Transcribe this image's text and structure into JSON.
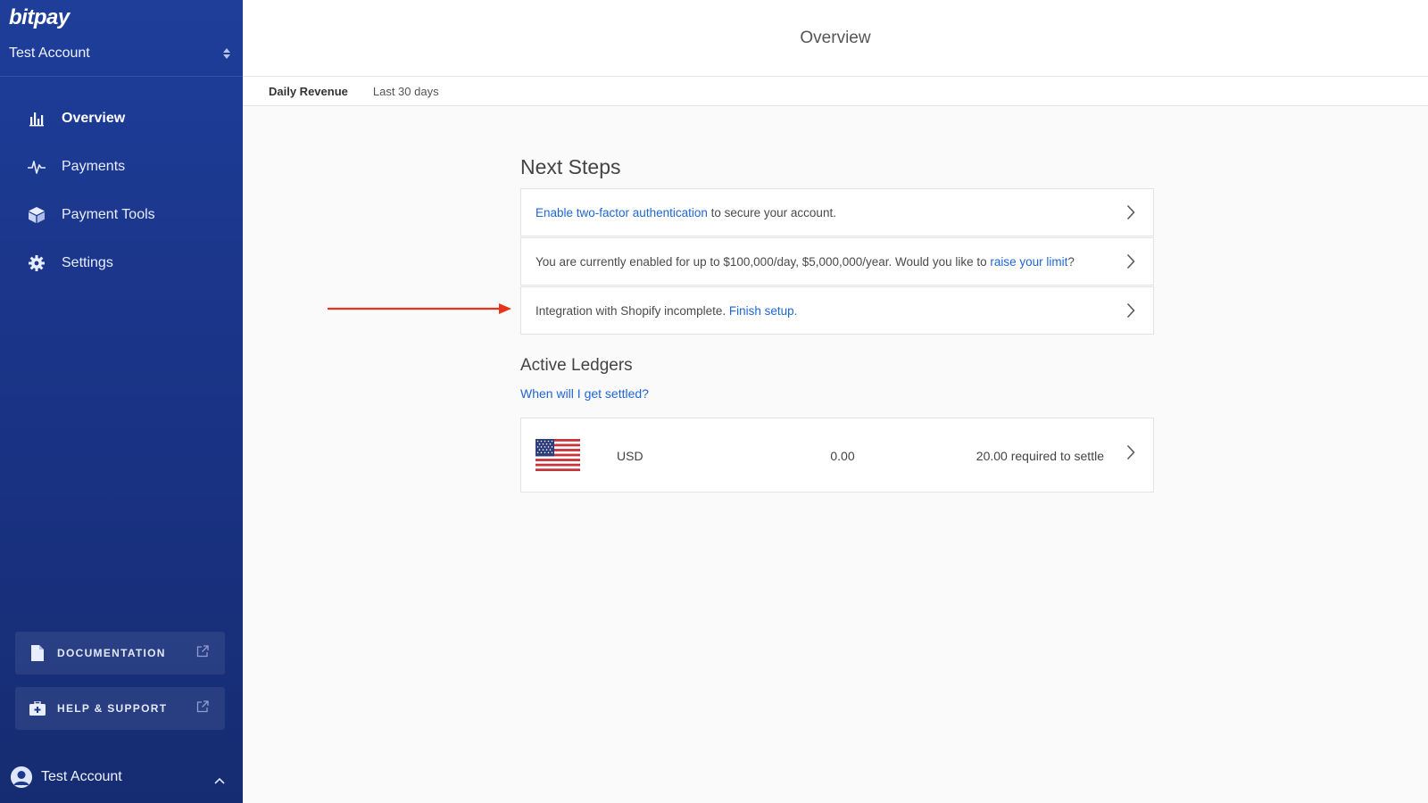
{
  "sidebar": {
    "logo": "bitpay",
    "account_switcher": "Test Account",
    "nav": [
      {
        "label": "Overview",
        "icon": "bar-chart-icon",
        "active": true
      },
      {
        "label": "Payments",
        "icon": "pulse-icon",
        "active": false
      },
      {
        "label": "Payment Tools",
        "icon": "cube-icon",
        "active": false
      },
      {
        "label": "Settings",
        "icon": "gear-icon",
        "active": false
      }
    ],
    "documentation_label": "DOCUMENTATION",
    "help_label": "HELP & SUPPORT",
    "footer_account": "Test Account"
  },
  "header": {
    "title": "Overview",
    "tabs": [
      "Daily Revenue",
      "Last 30 days"
    ]
  },
  "next_steps": {
    "title": "Next Steps",
    "items": [
      {
        "link": "Enable two-factor authentication",
        "text_after": " to secure your account."
      },
      {
        "text_before": "You are currently enabled for up to $100,000/day, $5,000,000/year. Would you like to ",
        "link": "raise your limit",
        "text_after": "?"
      },
      {
        "text_before": "Integration with Shopify incomplete. ",
        "link": "Finish setup."
      }
    ]
  },
  "ledgers": {
    "title": "Active Ledgers",
    "help_link": "When will I get settled?",
    "rows": [
      {
        "currency": "USD",
        "amount": "0.00",
        "requirement": "20.00 required to settle"
      }
    ]
  },
  "colors": {
    "sidebar": "#1e3e9a",
    "link": "#1f66d6",
    "annotation_arrow": "#e8341c"
  }
}
